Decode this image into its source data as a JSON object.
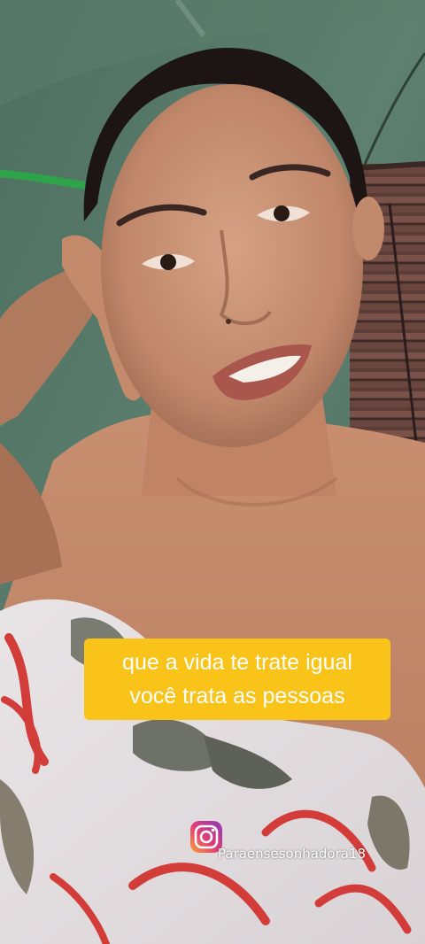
{
  "caption": {
    "line1": "que a vida te trate igual",
    "line2": "você trata as pessoas",
    "background_color": "#f9c31a",
    "text_color": "#ffffff"
  },
  "watermark": {
    "icon": "instagram-icon",
    "handle": "Paraensesonhadora18"
  }
}
